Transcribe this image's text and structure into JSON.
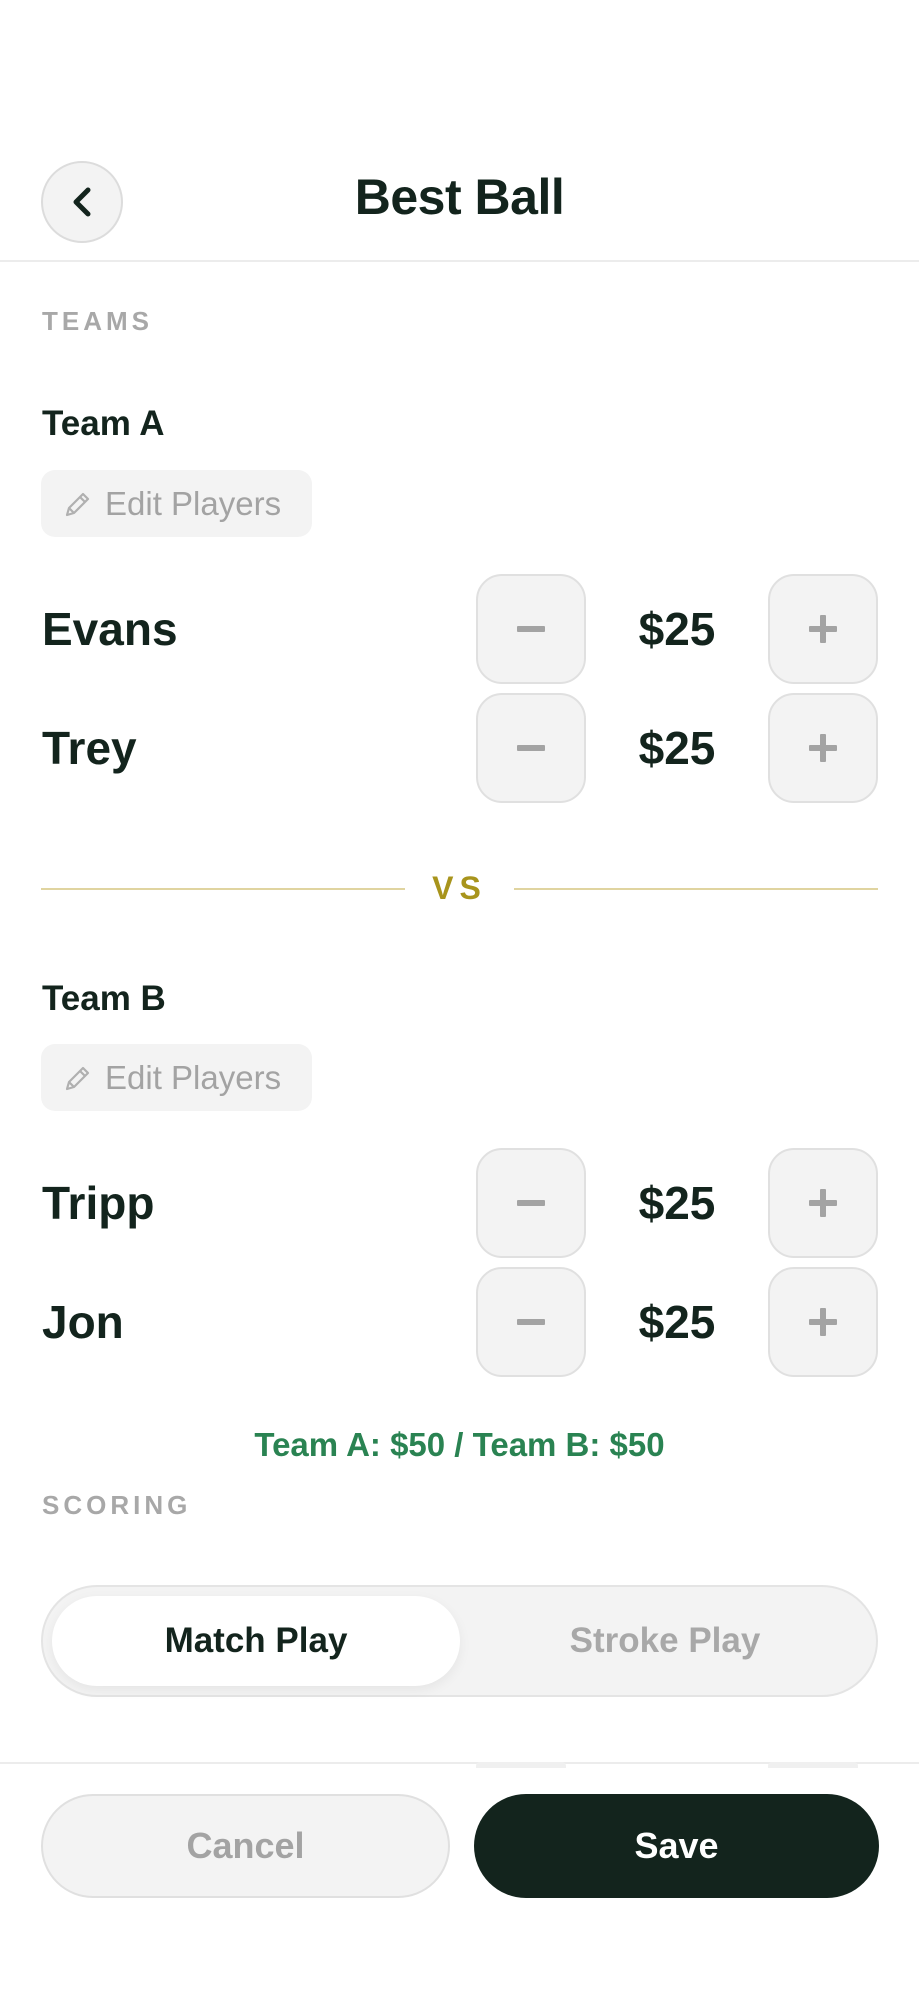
{
  "header": {
    "title": "Best Ball",
    "back_icon": "chevron-left-icon"
  },
  "teams_section": {
    "label": "TEAMS",
    "team_a": {
      "name": "Team A",
      "edit_label": "Edit Players",
      "players": [
        {
          "name": "Evans",
          "amount": "$25"
        },
        {
          "name": "Trey",
          "amount": "$25"
        }
      ]
    },
    "vs_label": "VS",
    "team_b": {
      "name": "Team B",
      "edit_label": "Edit Players",
      "players": [
        {
          "name": "Tripp",
          "amount": "$25"
        },
        {
          "name": "Jon",
          "amount": "$25"
        }
      ]
    },
    "totals": "Team A: $50 / Team B: $50"
  },
  "scoring_section": {
    "label": "SCORING",
    "options": [
      "Match Play",
      "Stroke Play"
    ],
    "selected": "Match Play"
  },
  "footer": {
    "cancel_label": "Cancel",
    "save_label": "Save"
  },
  "colors": {
    "primary_dark": "#13241d",
    "totals_green": "#2a8352",
    "vs_gold": "#a8941c",
    "muted_gray": "#a8a8a8"
  }
}
